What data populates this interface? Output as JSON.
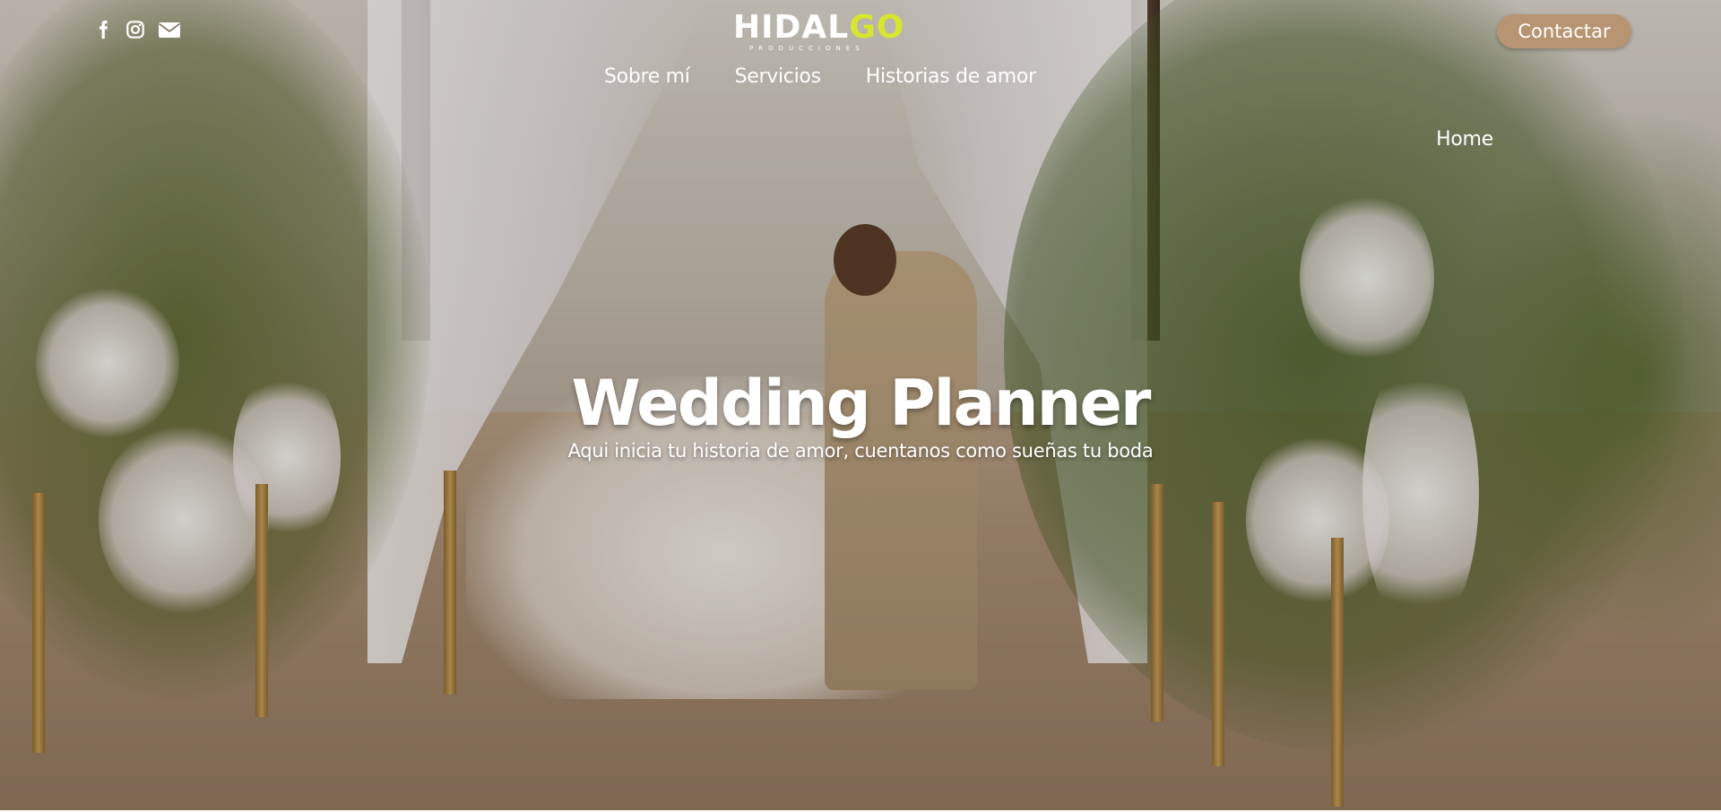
{
  "header": {
    "social_icons": [
      "facebook-icon",
      "instagram-icon",
      "envelope-icon"
    ],
    "logo": {
      "main_text": "HIDALGO",
      "sub_text": "PRODUCCIONES",
      "accent_color": "#d7e62f"
    },
    "nav": {
      "items": [
        {
          "label": "Home"
        },
        {
          "label": "Sobre mí"
        },
        {
          "label": "Servicios"
        },
        {
          "label": "Historias de amor"
        }
      ]
    },
    "contact_button": {
      "label": "Contactar",
      "color": "#b79472"
    }
  },
  "hero": {
    "title": "Wedding Planner",
    "subtitle": "Aqui inicia tu historia de amor, cuentanos como sueñas tu boda"
  }
}
